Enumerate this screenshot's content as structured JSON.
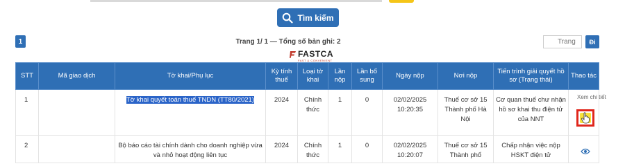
{
  "search": {
    "button_label": "Tìm kiếm"
  },
  "pagination": {
    "current_page": "1",
    "summary": "Trang 1/ 1 — Tổng số bản ghi: 2",
    "goto_placeholder": "Trang",
    "goto_button": "Đi"
  },
  "logo": {
    "name": "FASTCA",
    "tagline": "FAST & CONVENIENT"
  },
  "table": {
    "headers": [
      "STT",
      "Mã giao dịch",
      "Tờ khai/Phụ lục",
      "Kỳ tính thuế",
      "Loại tờ khai",
      "Lần nộp",
      "Lần bổ sung",
      "Ngày nộp",
      "Nơi nộp",
      "Tiến trình giải quyết hồ sơ (Trạng thái)",
      "Thao tác"
    ],
    "rows": [
      {
        "stt": "1",
        "ma_giao_dich": "",
        "to_khai": "Tờ khai quyết toán thuế TNDN (TT80/2021)",
        "ky_tinh_thue": "2024",
        "loai_to_khai": "Chính thức",
        "lan_nop": "1",
        "lan_bo_sung": "0",
        "ngay_nop": "02/02/2025 10:20:35",
        "noi_nop": "Thuế cơ sở 15 Thành phố Hà Nội",
        "tien_trinh": "Cơ quan thuế chư nhận hồ sơ khai thu điện tử của NNT",
        "tooltip": "Xem chi tiết"
      },
      {
        "stt": "2",
        "ma_giao_dich": "",
        "to_khai": "Bộ báo cáo tài chính dành cho doanh nghiệp vừa và nhỏ hoạt động liên tục",
        "ky_tinh_thue": "2024",
        "loai_to_khai": "Chính thức",
        "lan_nop": "1",
        "lan_bo_sung": "0",
        "ngay_nop": "02/02/2025 10:20:07",
        "noi_nop": "Thuế cơ sở 15 Thành phố",
        "tien_trinh": "Chấp nhận việc nộp HSKT điện tử"
      }
    ]
  },
  "colors": {
    "primary": "#2f6fb5",
    "highlight": "#e0261b",
    "selection": "#2a64c8"
  },
  "icons": {
    "search": "search-icon",
    "edit": "edit-icon",
    "view": "eye-icon"
  }
}
